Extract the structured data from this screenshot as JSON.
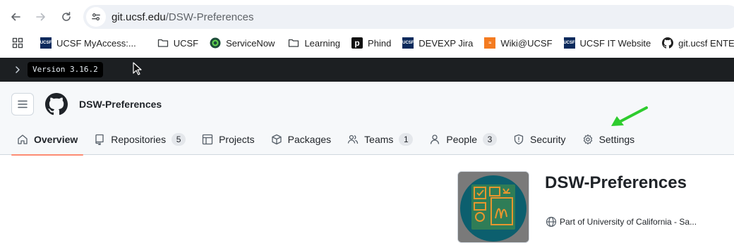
{
  "browser": {
    "url_host": "git.ucsf.edu",
    "url_path": "/DSW-Preferences",
    "bookmarks": [
      {
        "label": "UCSF MyAccess:...",
        "icon": "ucsf-logo-icon"
      },
      {
        "label": "UCSF",
        "icon": "folder-icon"
      },
      {
        "label": "ServiceNow",
        "icon": "servicenow-icon"
      },
      {
        "label": "Learning",
        "icon": "folder-icon"
      },
      {
        "label": "Phind",
        "icon": "phind-icon"
      },
      {
        "label": "DEVEXP Jira",
        "icon": "ucsf-logo-icon"
      },
      {
        "label": "Wiki@UCSF",
        "icon": "confluence-icon"
      },
      {
        "label": "UCSF IT Website",
        "icon": "ucsf-logo-icon"
      },
      {
        "label": "git.ucsf ENTERPRI...",
        "icon": "github-icon"
      }
    ]
  },
  "version_bar": {
    "version": "Version 3.16.2"
  },
  "org_header": {
    "title": "DSW-Preferences",
    "tabs": [
      {
        "label": "Overview",
        "icon": "home-icon",
        "active": true
      },
      {
        "label": "Repositories",
        "icon": "repo-icon",
        "count": "5"
      },
      {
        "label": "Projects",
        "icon": "table-icon"
      },
      {
        "label": "Packages",
        "icon": "package-icon"
      },
      {
        "label": "Teams",
        "icon": "people-icon",
        "count": "1"
      },
      {
        "label": "People",
        "icon": "person-icon",
        "count": "3"
      },
      {
        "label": "Security",
        "icon": "shield-icon"
      },
      {
        "label": "Settings",
        "icon": "gear-icon"
      }
    ]
  },
  "org_profile": {
    "name": "DSW-Preferences",
    "part_of": "Part of University of California - Sa..."
  },
  "colors": {
    "active_tab_underline": "#fd8c73",
    "annotation_arrow": "#2ecc2e",
    "version_bar_bg": "#1c1f22"
  }
}
